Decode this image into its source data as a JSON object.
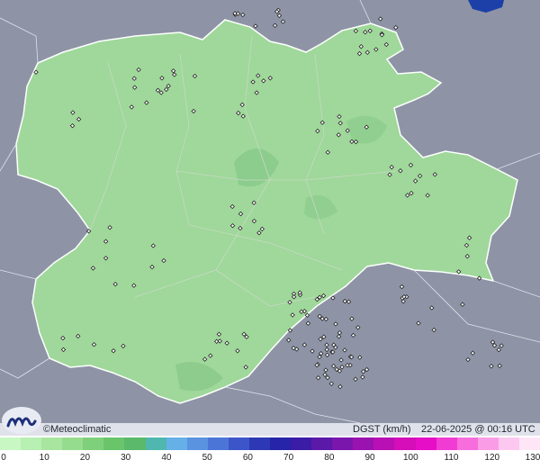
{
  "map": {
    "title": "DGST (km/h)",
    "datetime": "22-06-2025 @ 00:16 UTC",
    "credit": "©Meteoclimatic",
    "logo_icon": "meteoclimatic-logo-icon",
    "base_color": "#8e94a6",
    "region_color": "#9fd89a",
    "border_color": "#ffffff",
    "station_marker_color": "#222222"
  },
  "scale": {
    "ticks": [
      "0",
      "10",
      "20",
      "30",
      "40",
      "50",
      "60",
      "70",
      "80",
      "90",
      "100",
      "110",
      "120",
      "130"
    ],
    "colors": [
      "#c8f7c4",
      "#b8efb2",
      "#a8e6a0",
      "#96dc8e",
      "#7fd07a",
      "#6ac46a",
      "#5ab96a",
      "#4fb7b0",
      "#65b0e6",
      "#5a93e0",
      "#4c75d8",
      "#3c55c8",
      "#2d39b4",
      "#2624a8",
      "#3b1ca6",
      "#5a19a8",
      "#7a16ac",
      "#9a12b0",
      "#b810b4",
      "#d40eb8",
      "#e60ec6",
      "#f03cd2",
      "#f76ddc",
      "#fb9ce6",
      "#fdc8f0",
      "#ffe6f7"
    ]
  }
}
